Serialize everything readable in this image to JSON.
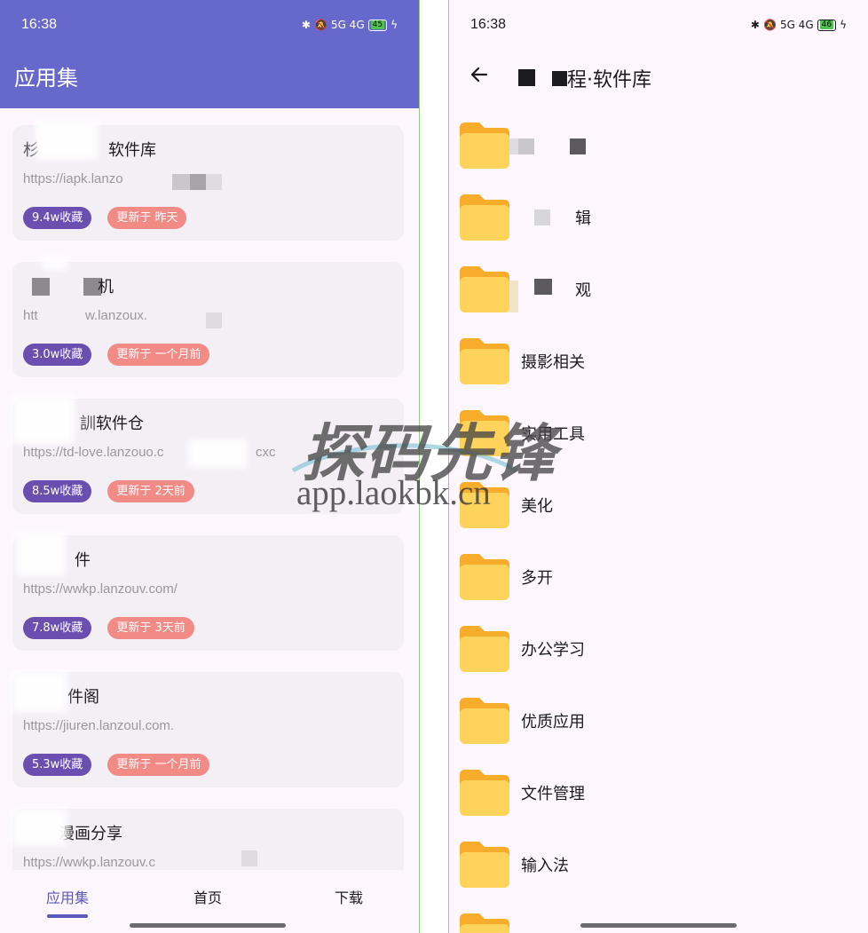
{
  "left": {
    "status": {
      "time": "16:38",
      "network": "5G 4G",
      "battery": "45"
    },
    "title": "应用集",
    "cards": [
      {
        "title": "软件库",
        "url": "https://iapk.lanzo",
        "favorites": "9.4w收藏",
        "updated": "更新于 昨天"
      },
      {
        "title": "机",
        "url": "w.lanzoux.",
        "favorites": "3.0w收藏",
        "updated": "更新于 一个月前"
      },
      {
        "title": "软件仓",
        "url": "td-love.lanzouo.c",
        "url_tail": "cxc",
        "favorites": "8.5w收藏",
        "updated": "更新于 2天前"
      },
      {
        "title": "件",
        "url": "https://wwkp.lanzouv.com/",
        "favorites": "7.8w收藏",
        "updated": "更新于 3天前"
      },
      {
        "title": "件阁",
        "url": "https://jiuren.lanzoul.com.",
        "favorites": "5.3w收藏",
        "updated": "更新于 一个月前"
      },
      {
        "title": "漫画分享",
        "url": "https://wwkp.lanzouv.c"
      }
    ],
    "nav": {
      "apps": "应用集",
      "home": "首页",
      "download": "下载"
    }
  },
  "right": {
    "status": {
      "time": "16:38",
      "network": "5G 4G",
      "battery": "46"
    },
    "title": "程·软件库",
    "folders": [
      {
        "label": ""
      },
      {
        "label": "辑"
      },
      {
        "label": "观"
      },
      {
        "label": "摄影相关"
      },
      {
        "label": "实用工具"
      },
      {
        "label": "美化"
      },
      {
        "label": "多开"
      },
      {
        "label": "办公学习"
      },
      {
        "label": "优质应用"
      },
      {
        "label": "文件管理"
      },
      {
        "label": "输入法"
      }
    ]
  },
  "watermark": {
    "logo": "探码先锋",
    "url": "app.laokbk.cn"
  },
  "colors": {
    "header": "#6768cc",
    "accent": "#5b58b5",
    "fav_badge": "#6a4fb0",
    "update_badge": "#f28a86",
    "folder": "#fdd35c",
    "folder_tab": "#f7ac2b"
  }
}
